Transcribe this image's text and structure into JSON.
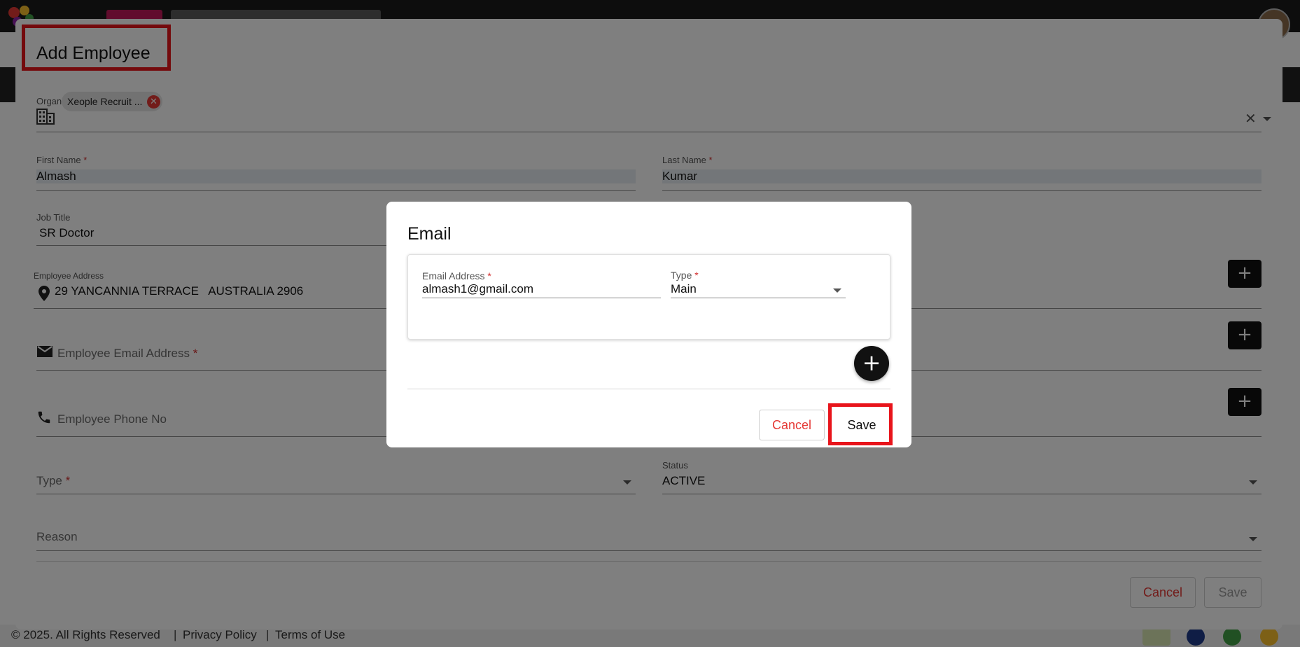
{
  "main_dialog": {
    "title": "Add Employee",
    "organisation": {
      "label": "Organisation",
      "required_mark": "*",
      "chip_text": "Xeople Recruit ...",
      "chip_remove_glyph": "✕",
      "clear_glyph": "✕"
    },
    "first_name": {
      "label": "First Name",
      "required_mark": "*",
      "value": "Almash"
    },
    "last_name": {
      "label": "Last Name",
      "required_mark": "*",
      "value": "Kumar"
    },
    "job_title": {
      "label": "Job Title",
      "value": "SR Doctor"
    },
    "employee_address": {
      "label": "Employee Address",
      "value": "29 YANCANNIA TERRACE   AUSTRALIA 2906",
      "icon": "location-pin-icon"
    },
    "email_field": {
      "placeholder": "Employee Email Address",
      "required_mark": "*",
      "icon": "mail-icon"
    },
    "phone_field": {
      "placeholder": "Employee Phone No",
      "icon": "phone-icon"
    },
    "type_field": {
      "placeholder": "Type",
      "required_mark": "*"
    },
    "status_field": {
      "label": "Status",
      "value": "ACTIVE"
    },
    "reason_field": {
      "placeholder": "Reason"
    },
    "add_glyph": "+",
    "cancel_label": "Cancel",
    "save_label": "Save"
  },
  "email_dialog": {
    "title": "Email",
    "email_address": {
      "label": "Email Address",
      "required_mark": "*",
      "value": "almash1@gmail.com"
    },
    "type": {
      "label": "Type",
      "required_mark": "*",
      "value": "Main"
    },
    "add_glyph": "+",
    "cancel_label": "Cancel",
    "save_label": "Save"
  },
  "footer": {
    "copyright": "© 2025. All Rights Reserved",
    "separator": "|",
    "privacy": "Privacy Policy",
    "terms": "Terms of Use"
  },
  "colors": {
    "accent_red": "#e53935",
    "highlight_red": "#e8141b",
    "primary_black": "#111111"
  }
}
